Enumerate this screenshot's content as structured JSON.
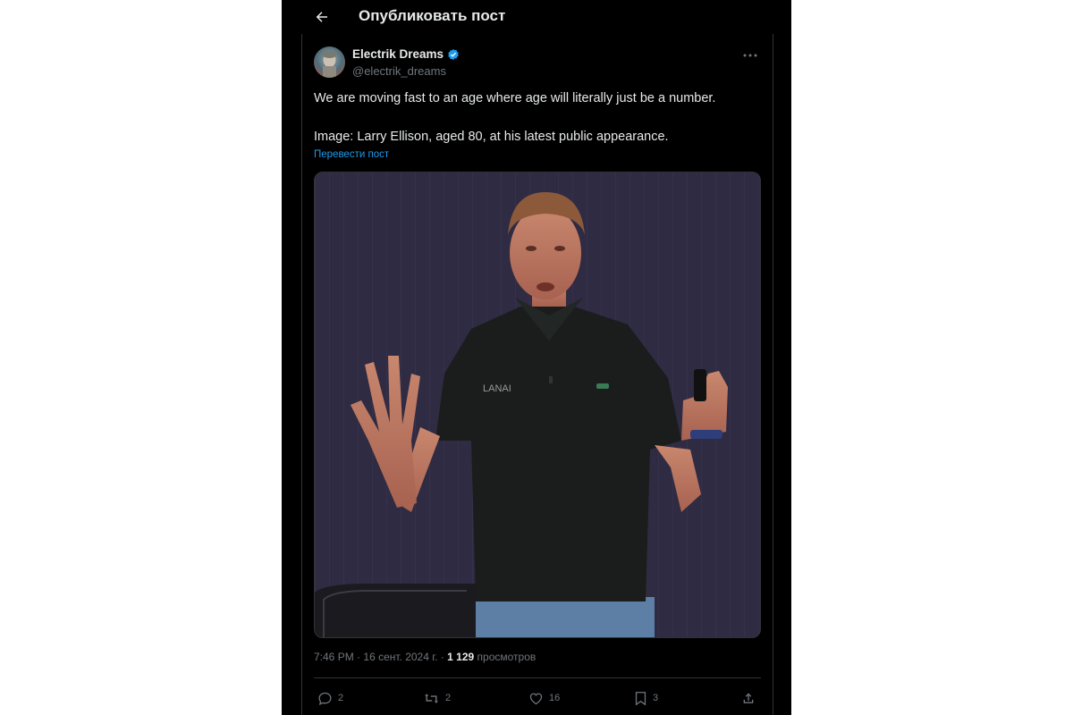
{
  "header": {
    "title": "Опубликовать пост",
    "back_icon": "arrow-left-icon"
  },
  "post": {
    "author_name": "Electrik Dreams",
    "author_handle": "@electrik_dreams",
    "verified_icon": "verified-badge-icon",
    "more_icon": "more-horizontal-icon",
    "text_line1": "We are moving fast to an age where age will literally just be a number.",
    "text_line2": "Image: Larry Ellison, aged 80, at his latest public appearance.",
    "translate_label": "Перевести пост",
    "time": "7:46 PM",
    "date": "16 сент. 2024 г.",
    "views_count": "1 129",
    "views_label": "просмотров",
    "media_shirt_text": "LANAI"
  },
  "actions": {
    "replies": "2",
    "reposts": "2",
    "likes": "16",
    "bookmarks": "3"
  },
  "colors": {
    "background": "#000000",
    "text": "#e7e9ea",
    "muted": "#71767b",
    "link": "#1d9bf0",
    "verified": "#1d9bf0",
    "media_backdrop": "#2f2b42"
  }
}
